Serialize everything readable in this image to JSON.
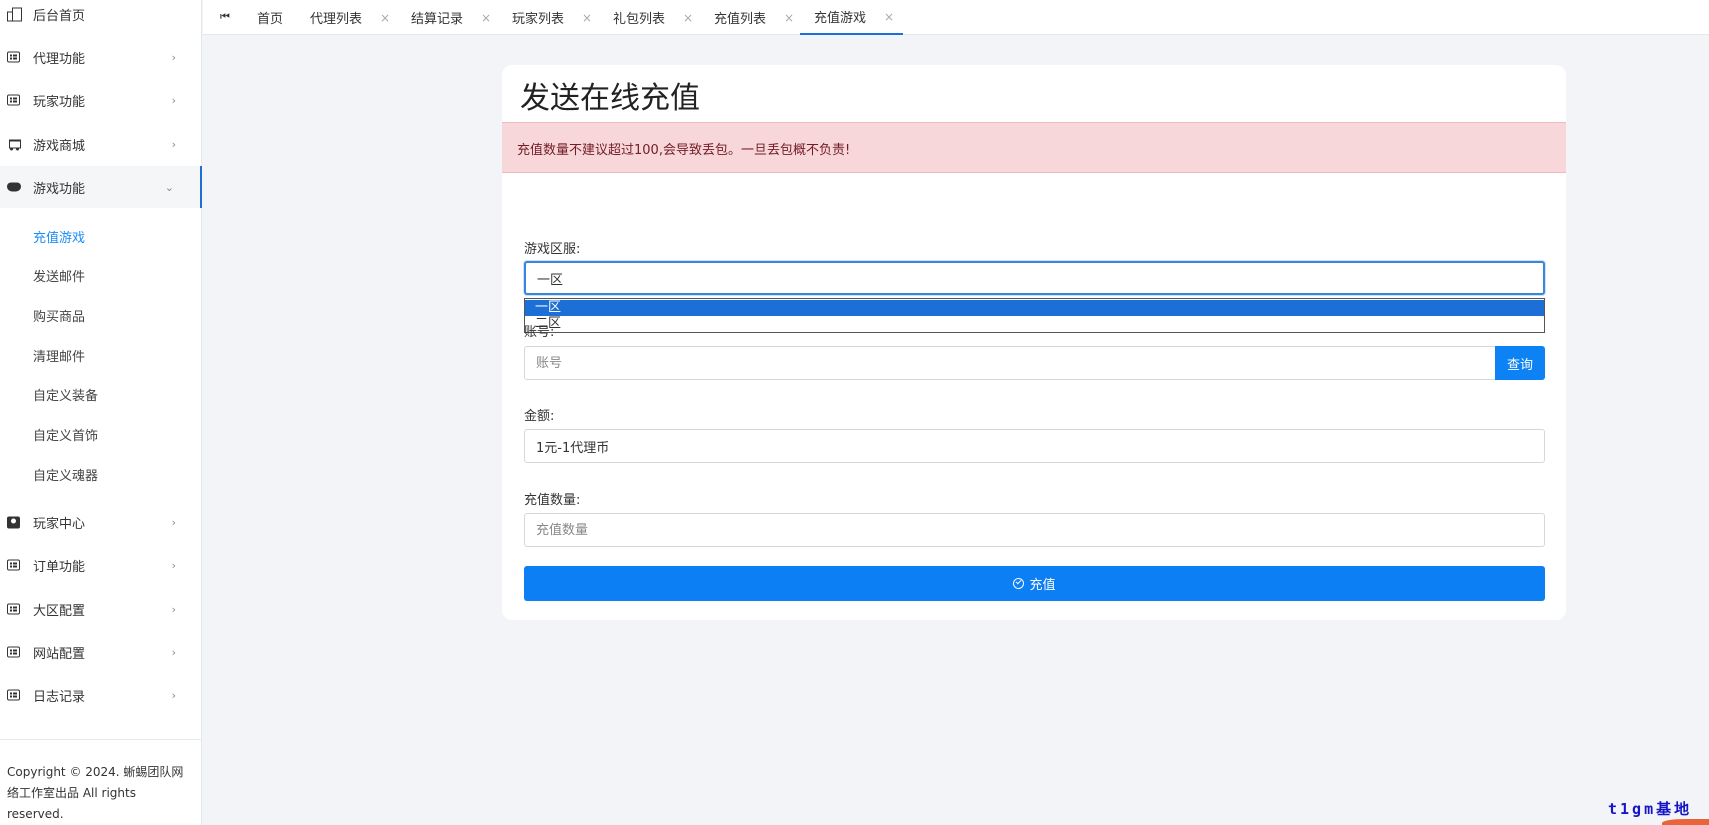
{
  "sidebar": {
    "items": [
      {
        "label": "后台首页",
        "icon": "home-icon",
        "has_chevron": false
      },
      {
        "label": "代理功能",
        "icon": "screen-icon",
        "has_chevron": true,
        "chevron": "›"
      },
      {
        "label": "玩家功能",
        "icon": "screen-icon",
        "has_chevron": true,
        "chevron": "›"
      },
      {
        "label": "游戏商城",
        "icon": "cart-icon",
        "has_chevron": true,
        "chevron": "›"
      },
      {
        "label": "游戏功能",
        "icon": "gamepad-icon",
        "has_chevron": true,
        "chevron": "⌄",
        "expanded": true
      }
    ],
    "submenu": [
      {
        "label": "充值游戏",
        "active": true
      },
      {
        "label": "发送邮件"
      },
      {
        "label": "购买商品"
      },
      {
        "label": "清理邮件"
      },
      {
        "label": "自定义装备"
      },
      {
        "label": "自定义首饰"
      },
      {
        "label": "自定义魂器"
      }
    ],
    "items_after": [
      {
        "label": "玩家中心",
        "icon": "contact-icon",
        "chevron": "›"
      },
      {
        "label": "订单功能",
        "icon": "screen-icon",
        "chevron": "›"
      },
      {
        "label": "大区配置",
        "icon": "screen-icon",
        "chevron": "›"
      },
      {
        "label": "网站配置",
        "icon": "screen-icon",
        "chevron": "›"
      },
      {
        "label": "日志记录",
        "icon": "screen-icon",
        "chevron": "›"
      }
    ],
    "copyright": "Copyright © 2024. 蜥蜴团队网络工作室出品 All rights reserved."
  },
  "tabs": {
    "first_icon": "⏮",
    "items": [
      {
        "label": "首页",
        "closable": false
      },
      {
        "label": "代理列表",
        "closable": true
      },
      {
        "label": "结算记录",
        "closable": true
      },
      {
        "label": "玩家列表",
        "closable": true
      },
      {
        "label": "礼包列表",
        "closable": true
      },
      {
        "label": "充值列表",
        "closable": true
      },
      {
        "label": "充值游戏",
        "closable": true,
        "active": true
      }
    ],
    "close_glyph": "×"
  },
  "main": {
    "title": "发送在线充值",
    "alert": "充值数量不建议超过100,会导致丢包。一旦丢包概不负责!",
    "server_label": "游戏区服:",
    "server_value": "一区",
    "server_options": [
      "一区",
      "二区"
    ],
    "account_label": "账号:",
    "account_placeholder": "账号",
    "query_button": "查询",
    "amount_label": "金额:",
    "amount_value": "1元-1代理币",
    "quantity_label": "充值数量:",
    "quantity_placeholder": "充值数量",
    "submit_button": "充值"
  },
  "watermark": "t1gm基地",
  "colors": {
    "accent": "#1d6fd8",
    "button": "#0d7ff5",
    "alert_bg": "#f8d7da",
    "alert_text": "#721c24",
    "active_sub": "#1d8cf8"
  }
}
